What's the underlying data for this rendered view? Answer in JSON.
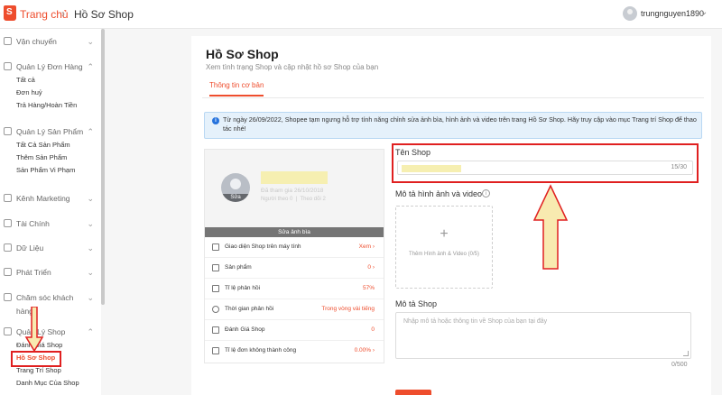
{
  "header": {
    "home": "Trang chủ",
    "separator": "›",
    "current": "Hồ Sơ Shop",
    "username": "trungnguyen1890"
  },
  "sidebar": {
    "sections": [
      {
        "label": "Vận chuyển",
        "items": []
      },
      {
        "label": "Quản Lý Đơn Hàng",
        "items": [
          "Tất cả",
          "Đơn huỷ",
          "Trả Hàng/Hoàn Tiền"
        ]
      },
      {
        "label": "Quản Lý Sản Phẩm",
        "items": [
          "Tất Cả Sản Phẩm",
          "Thêm Sản Phẩm",
          "Sản Phẩm Vi Phạm"
        ]
      },
      {
        "label": "Kênh Marketing",
        "items": []
      },
      {
        "label": "Tài Chính",
        "items": []
      },
      {
        "label": "Dữ Liệu",
        "items": []
      },
      {
        "label": "Phát Triển",
        "items": []
      },
      {
        "label": "Chăm sóc khách",
        "label2": "hàng",
        "items": []
      },
      {
        "label": "Quản Lý Shop",
        "items": [
          "Đánh Giá Shop",
          "Hồ Sơ Shop",
          "Trang Trí Shop",
          "Danh Mục Của Shop"
        ]
      }
    ]
  },
  "main": {
    "title": "Hồ Sơ Shop",
    "subtitle": "Xem tình trạng Shop và cập nhật hồ sơ Shop của bạn",
    "tab": "Thông tin cơ bản",
    "notice": "Từ ngày 26/09/2022, Shopee tạm ngưng hỗ trợ tính năng chỉnh sửa ảnh bìa, hình ảnh và video trên trang Hồ Sơ Shop. Hãy truy cập vào mục Trang trí Shop để thao tác nhé!"
  },
  "preview": {
    "avatar_label": "Sửa",
    "joined": "Đã tham gia 26/10/2018",
    "followers": "Người theo 0",
    "following": "Theo dõi 2",
    "cover_button": "Sửa ảnh bìa",
    "rows": [
      {
        "label": "Giao diện Shop trên máy tính",
        "value": "Xem ›"
      },
      {
        "label": "Sản phẩm",
        "value": "0 ›"
      },
      {
        "label": "Tỉ lệ phản hồi",
        "value": "57%"
      },
      {
        "label": "Thời gian phản hồi",
        "value": "Trong vòng vài tiếng"
      },
      {
        "label": "Đánh Giá Shop",
        "value": "0"
      },
      {
        "label": "Tỉ lệ đơn không thành công",
        "value": "0.00% ›"
      }
    ]
  },
  "form": {
    "shop_name_label": "Tên Shop",
    "shop_name_count": "15/30",
    "media_label": "Mô tả hình ảnh và video",
    "upload_plus": "+",
    "upload_text": "Thêm Hình ảnh & Video (0/5)",
    "desc_label": "Mô tả Shop",
    "desc_placeholder": "Nhập mô tả hoặc thông tin về Shop của bạn tại đây",
    "desc_count": "0/500"
  },
  "colors": {
    "accent": "#ee4d2d",
    "highlight": "#e02020",
    "arrow_fill": "#f8eab0",
    "notice_bg": "#e5f1fb"
  }
}
